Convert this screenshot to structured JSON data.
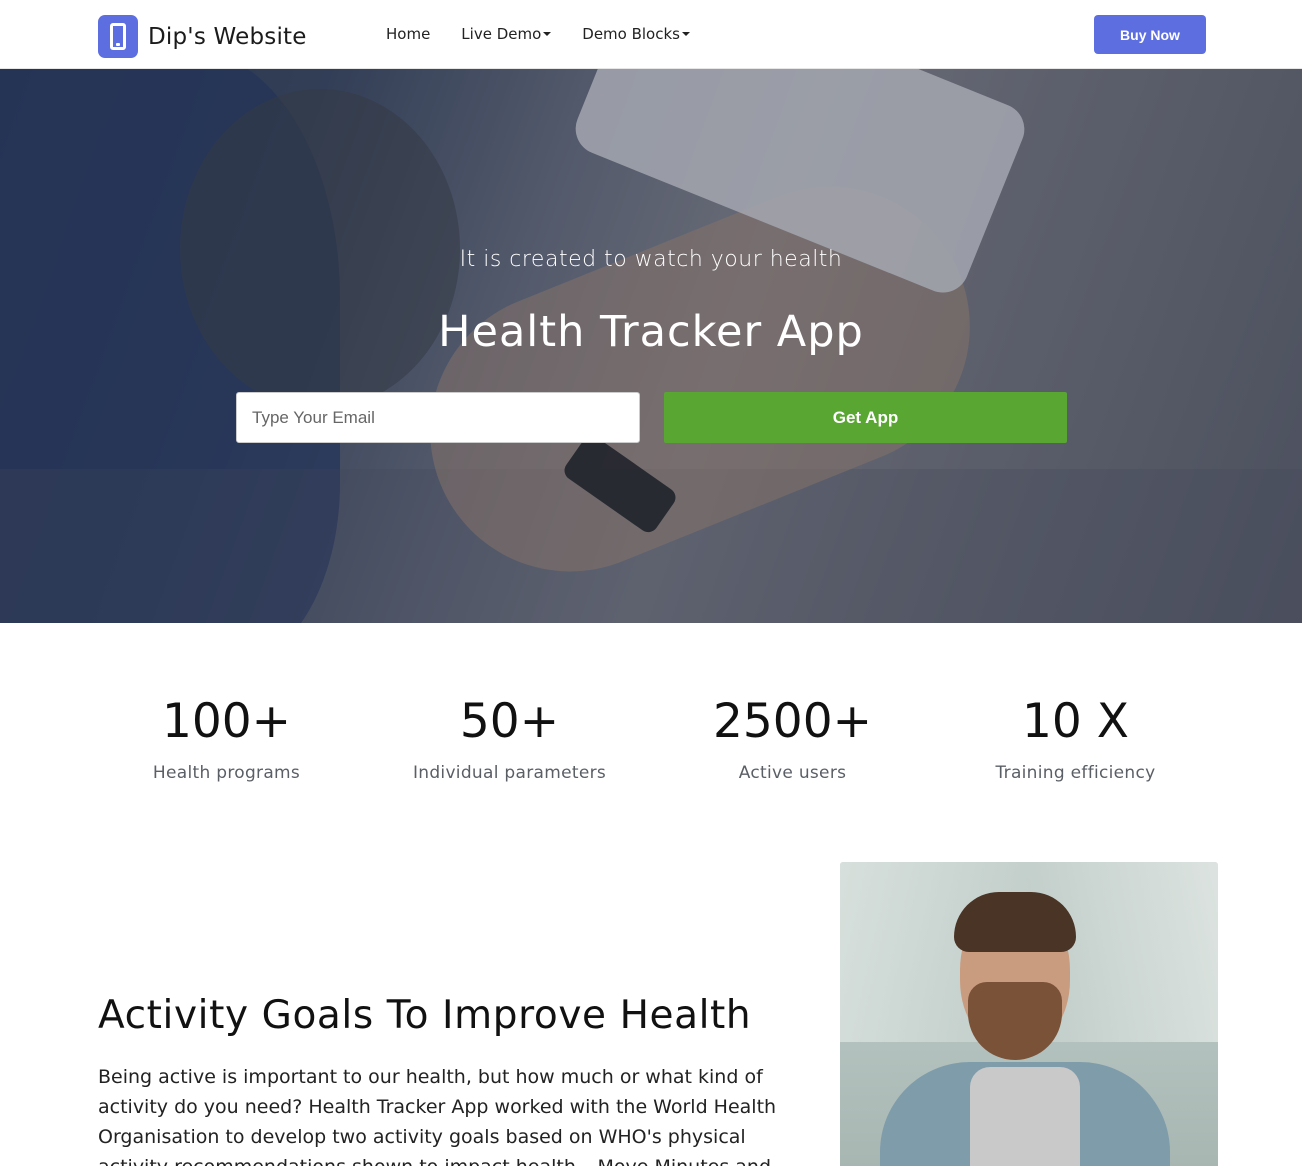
{
  "navbar": {
    "brand": "Dip's Website",
    "links": [
      {
        "label": "Home",
        "dropdown": false
      },
      {
        "label": "Live Demo",
        "dropdown": true
      },
      {
        "label": "Demo Blocks",
        "dropdown": true
      }
    ],
    "buy_button": "Buy Now"
  },
  "hero": {
    "subtitle": "It is created to watch your health",
    "title": "Health Tracker App",
    "email_placeholder": "Type Your Email",
    "cta": "Get App"
  },
  "stats": [
    {
      "value": "100+",
      "label": "Health programs"
    },
    {
      "value": "50+",
      "label": "Individual parameters"
    },
    {
      "value": "2500+",
      "label": "Active users"
    },
    {
      "value": "10 X",
      "label": "Training efficiency"
    }
  ],
  "activity": {
    "title": "Activity Goals To Improve Health",
    "text": "Being active is important to our health, but how much or what kind of activity do you need? Health Tracker App worked with the World Health Organisation to develop two activity goals based on WHO's physical activity recommendations shown to impact health – Move Minutes and"
  },
  "colors": {
    "accent": "#5d6fe0",
    "cta_green": "#59a632"
  }
}
